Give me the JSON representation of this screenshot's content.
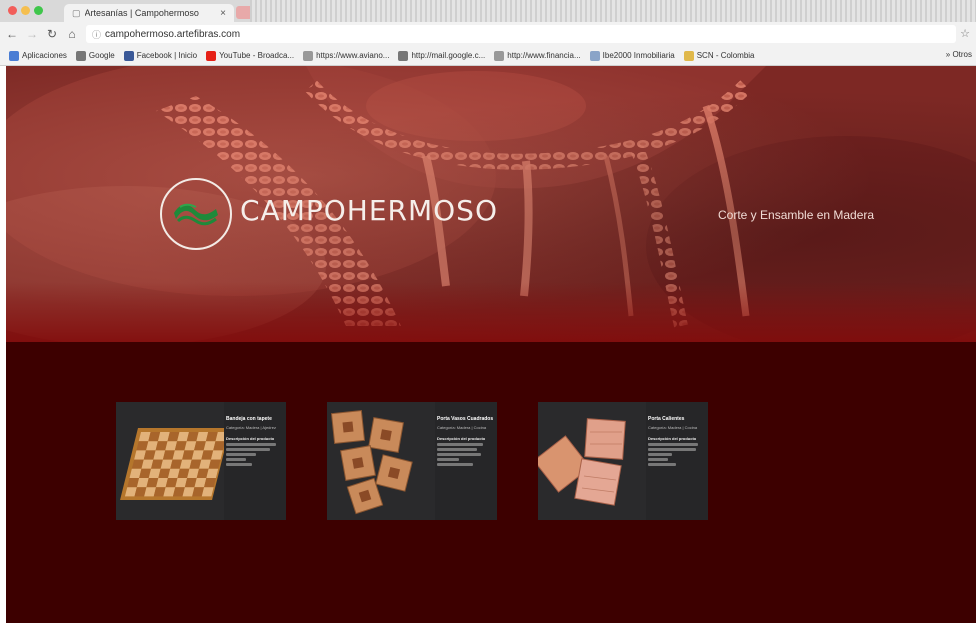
{
  "browser": {
    "tab_title": "Artesanías | Campohermoso",
    "tab_close": "×",
    "url": "campohermoso.artefibras.com",
    "bookmarks": [
      {
        "label": "Aplicaciones",
        "icon": "apps-icon",
        "color": "#4a7dd4"
      },
      {
        "label": "Google",
        "icon": "google-icon",
        "color": "#777777"
      },
      {
        "label": "Facebook | Inicio",
        "icon": "facebook-icon",
        "color": "#3b5998"
      },
      {
        "label": "YouTube - Broadca...",
        "icon": "youtube-icon",
        "color": "#e62117"
      },
      {
        "label": "https://www.aviano...",
        "icon": "page-icon",
        "color": "#999999"
      },
      {
        "label": "http://mail.google.c...",
        "icon": "google-icon",
        "color": "#777777"
      },
      {
        "label": "http://www.financia...",
        "icon": "page-icon",
        "color": "#999999"
      },
      {
        "label": "Ibe2000 Inmobiliaria",
        "icon": "folder-icon",
        "color": "#8aa4c8"
      },
      {
        "label": "SCN - Colombia",
        "icon": "folder-icon",
        "color": "#e0b84a"
      }
    ],
    "bookmarks_more": "» Otros"
  },
  "site": {
    "brand": "CAMPOHERMOSO",
    "tagline": "Corte y Ensamble en Madera"
  },
  "products": [
    {
      "title": "Bandeja con tapete",
      "subtitle": "Categoría: Madera | Ajedrez",
      "desc_title": "Descripción del producto",
      "image": "chessboard-tray"
    },
    {
      "title": "Porta Vasos Cuadrados",
      "subtitle": "Categoría: Madera | Cocina",
      "desc_title": "Descripción del producto",
      "image": "square-coasters"
    },
    {
      "title": "Porta Calientes",
      "subtitle": "Categoría: Madera | Cocina",
      "desc_title": "Descripción del producto",
      "image": "trivets"
    }
  ],
  "colors": {
    "page_background": "#3d0000",
    "logo_green": "#1e8a3a",
    "hero_red": "#7a2622"
  }
}
